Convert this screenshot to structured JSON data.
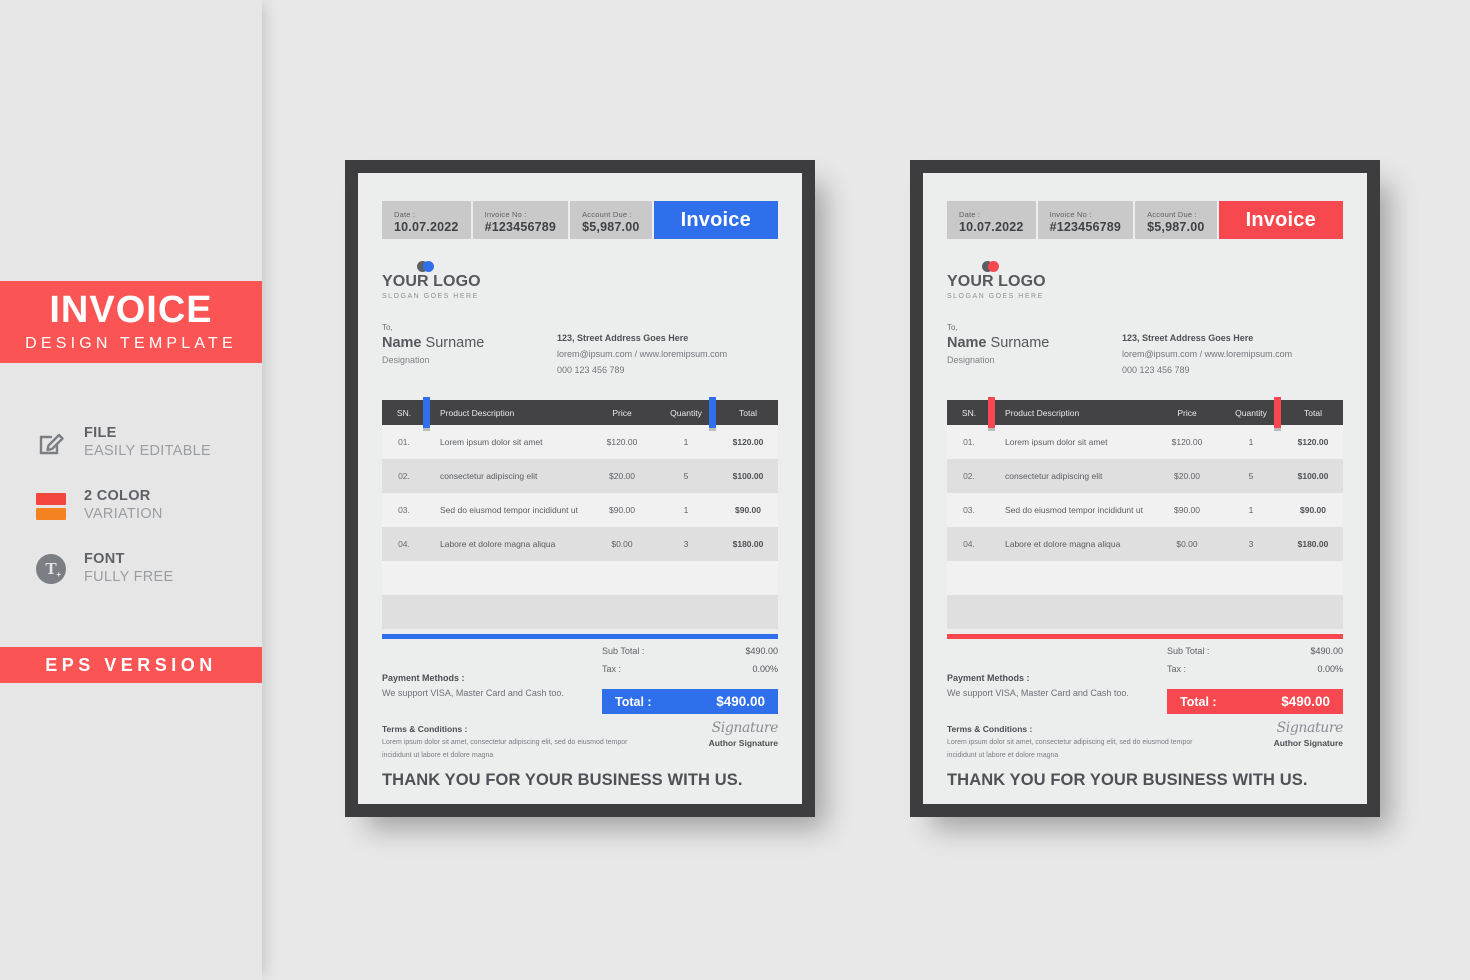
{
  "colors": {
    "blue_accent": "#2f6fec",
    "red_accent": "#f8484f",
    "banner_red": "#fb5454",
    "swatch_red": "#f2453d",
    "swatch_orange": "#f58220",
    "frame_dark": "#3d3d3f",
    "table_header_dark": "#434345",
    "page_bg": "#eceded",
    "canvas_bg": "#e8e8e8",
    "sidebar_bg": "#e6e6e6",
    "logo_gray": "#5b5e63"
  },
  "sidebar": {
    "banner": {
      "title": "INVOICE",
      "subtitle": "DESIGN TEMPLATE"
    },
    "features": [
      {
        "icon": "pencil-edit-icon",
        "title": "FILE",
        "subtitle": "EASILY EDITABLE"
      },
      {
        "icon": "color-swatch-icon",
        "title": "2 COLOR",
        "subtitle": "VARIATION"
      },
      {
        "icon": "font-type-icon",
        "title": "FONT",
        "subtitle": "FULLY FREE"
      }
    ],
    "eps_banner": "EPS VERSION"
  },
  "invoice": {
    "meta": [
      {
        "label": "Date :",
        "value": "10.07.2022"
      },
      {
        "label": "Invoice No :",
        "value": "#123456789"
      },
      {
        "label": "Account Due :",
        "value": "$5,987.00"
      }
    ],
    "badge": "Invoice",
    "logo": {
      "name": "YOUR LOGO",
      "slogan": "SLOGAN GOES HERE"
    },
    "bill_to": {
      "to_label": "To,",
      "name_bold": "Name",
      "name_rest": " Surname",
      "designation": "Designation"
    },
    "address": {
      "line1": "123, Street Address Goes Here",
      "line2": "lorem@ipsum.com / www.loremipsum.com",
      "line3": "000 123 456 789"
    },
    "table": {
      "headers": [
        "SN.",
        "Product Description",
        "Price",
        "Quantity",
        "Total"
      ],
      "rows": [
        {
          "sn": "01.",
          "desc": "Lorem ipsum dolor sit amet",
          "price": "$120.00",
          "qty": "1",
          "total": "$120.00"
        },
        {
          "sn": "02.",
          "desc": "consectetur adipiscing elit",
          "price": "$20.00",
          "qty": "5",
          "total": "$100.00"
        },
        {
          "sn": "03.",
          "desc": "Sed do eiusmod tempor incididunt ut",
          "price": "$90.00",
          "qty": "1",
          "total": "$90.00"
        },
        {
          "sn": "04.",
          "desc": "Labore et dolore magna aliqua",
          "price": "$0.00",
          "qty": "3",
          "total": "$180.00"
        },
        {
          "sn": "",
          "desc": "",
          "price": "",
          "qty": "",
          "total": ""
        },
        {
          "sn": "",
          "desc": "",
          "price": "",
          "qty": "",
          "total": ""
        }
      ]
    },
    "totals": {
      "subtotal_label": "Sub Total :",
      "subtotal_value": "$490.00",
      "tax_label": "Tax :",
      "tax_value": "0.00%",
      "grand_label": "Total :",
      "grand_value": "$490.00"
    },
    "payment": {
      "title": "Payment Methods :",
      "text": "We support VISA, Master Card and Cash too."
    },
    "terms": {
      "title": "Terms & Conditions :",
      "line1": "Lorem ipsum dolor sit amet, consectetur adipiscing elit, sed do eiusmod tempor",
      "line2": "incididunt ut labore et dolore magna"
    },
    "signature": {
      "script": "Signature",
      "label": "Author Signature"
    },
    "thanks": "THANK YOU FOR YOUR BUSINESS WITH US."
  }
}
